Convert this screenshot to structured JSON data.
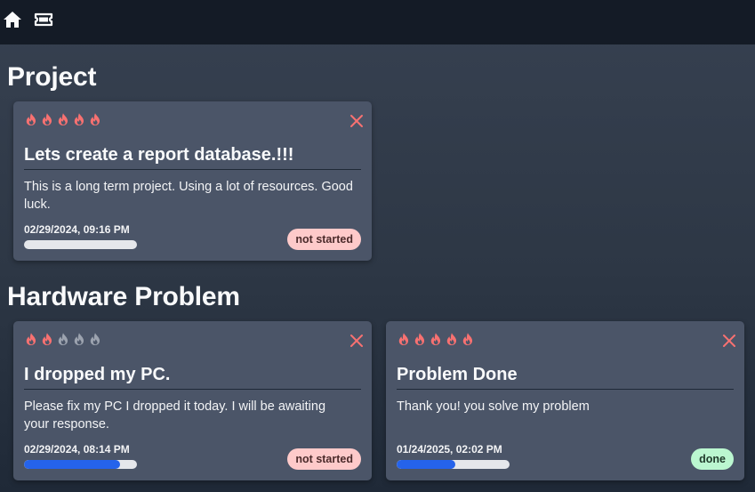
{
  "nav": {
    "home_icon": "home-icon",
    "ticket_icon": "ticket-icon"
  },
  "colors": {
    "flame_active": "#f87171",
    "flame_inactive": "#9ca3af",
    "close": "#f87171",
    "progress_fill": "#2563eb",
    "progress_track": "#e5e7eb",
    "status_not_started_bg": "#fecaca",
    "status_not_started_fg": "#4b2a2a",
    "status_done_bg": "#bbf7d0",
    "status_done_fg": "#1f3a2a"
  },
  "sections": [
    {
      "title": "Project",
      "cards": [
        {
          "priority": 5,
          "title": "Lets create a report database.!!!",
          "description": "This is a long term project. Using a lot of resources. Good luck.",
          "date": "02/29/2024, 09:16 PM",
          "progress": 0,
          "status": "not started"
        }
      ]
    },
    {
      "title": "Hardware Problem",
      "cards": [
        {
          "priority": 2,
          "title": "I dropped my PC.",
          "description": "Please fix my PC I dropped it today. I will be awaiting your response.",
          "date": "02/29/2024, 08:14 PM",
          "progress": 0.85,
          "status": "not started"
        },
        {
          "priority": 5,
          "title": "Problem Done",
          "description": "Thank you! you solve my problem",
          "date": "01/24/2025, 02:02 PM",
          "progress": 0.52,
          "status": "done"
        }
      ]
    }
  ]
}
